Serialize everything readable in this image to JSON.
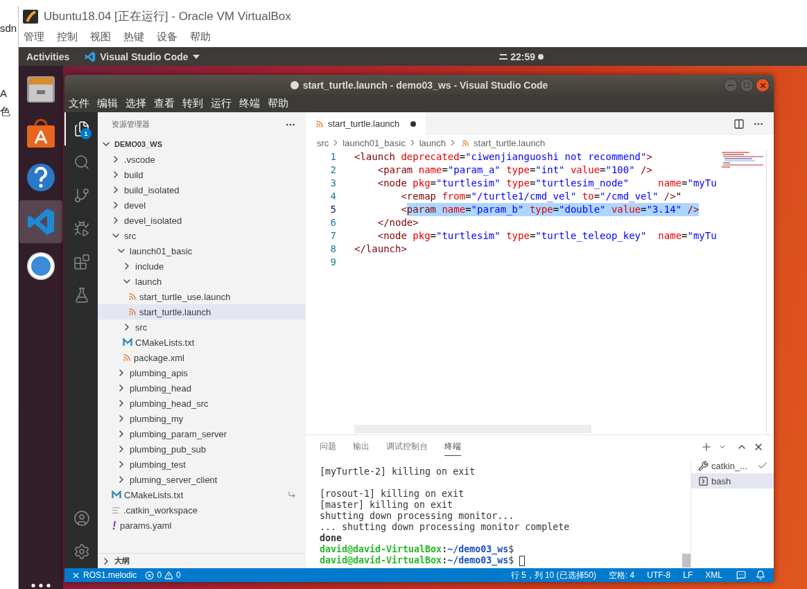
{
  "host_edge": [
    "sdn",
    "A",
    "色"
  ],
  "virtualbox": {
    "title": "Ubuntu18.04 [正在运行] - Oracle VM VirtualBox",
    "menu": [
      "管理",
      "控制",
      "视图",
      "热键",
      "设备",
      "帮助"
    ]
  },
  "top_bar": {
    "activities": "Activities",
    "app": "Visual Studio Code",
    "clock": "22:59"
  },
  "dock": [
    {
      "kind": "files",
      "selected": false
    },
    {
      "kind": "software",
      "selected": false
    },
    {
      "kind": "help",
      "selected": false
    },
    {
      "kind": "vscode",
      "selected": true
    },
    {
      "kind": "chrome",
      "selected": false
    }
  ],
  "vscode": {
    "title": "start_turtle.launch - demo03_ws - Visual Studio Code",
    "dirty": true,
    "menu": [
      "文件",
      "编辑",
      "选择",
      "查看",
      "转到",
      "运行",
      "终端",
      "帮助"
    ],
    "activity": [
      {
        "kind": "explorer",
        "selected": true,
        "badge": "1"
      },
      {
        "kind": "search",
        "selected": false
      },
      {
        "kind": "source-control",
        "selected": false
      },
      {
        "kind": "run",
        "selected": false
      },
      {
        "kind": "extensions",
        "selected": false
      },
      {
        "kind": "testing",
        "selected": false
      }
    ],
    "activity_bottom": [
      {
        "kind": "account"
      },
      {
        "kind": "settings"
      }
    ],
    "sidebar": {
      "title": "资源管理器",
      "root": {
        "name": "DEMO03_WS",
        "expanded": true
      },
      "tree": [
        {
          "name": ".vscode",
          "kind": "folder",
          "expanded": false,
          "selected": false
        },
        {
          "name": "build",
          "kind": "folder",
          "expanded": false,
          "selected": false
        },
        {
          "name": "build_isolated",
          "kind": "folder",
          "expanded": false,
          "selected": false
        },
        {
          "name": "devel",
          "kind": "folder",
          "expanded": false,
          "selected": false
        },
        {
          "name": "devel_isolated",
          "kind": "folder",
          "expanded": false,
          "selected": false
        },
        {
          "name": "src",
          "kind": "folder",
          "expanded": true,
          "selected": false,
          "children": [
            {
              "name": "launch01_basic",
              "kind": "folder",
              "expanded": true,
              "selected": false,
              "children": [
                {
                  "name": "include",
                  "kind": "folder",
                  "expanded": false,
                  "selected": false
                },
                {
                  "name": "launch",
                  "kind": "folder",
                  "expanded": true,
                  "selected": false,
                  "children": [
                    {
                      "name": "start_turtle_use.launch",
                      "kind": "xml",
                      "selected": false
                    },
                    {
                      "name": "start_turtle.launch",
                      "kind": "xml",
                      "selected": true
                    }
                  ]
                },
                {
                  "name": "src",
                  "kind": "folder",
                  "expanded": false,
                  "selected": false
                },
                {
                  "name": "CMakeLists.txt",
                  "kind": "cmake",
                  "selected": false
                },
                {
                  "name": "package.xml",
                  "kind": "xml",
                  "selected": false
                }
              ]
            },
            {
              "name": "plumbing_apis",
              "kind": "folder",
              "expanded": false,
              "selected": false
            },
            {
              "name": "plumbing_head",
              "kind": "folder",
              "expanded": false,
              "selected": false
            },
            {
              "name": "plumbing_head_src",
              "kind": "folder",
              "expanded": false,
              "selected": false
            },
            {
              "name": "plumbing_my",
              "kind": "folder",
              "expanded": false,
              "selected": false
            },
            {
              "name": "plumbing_param_server",
              "kind": "folder",
              "expanded": false,
              "selected": false
            },
            {
              "name": "plumbing_pub_sub",
              "kind": "folder",
              "expanded": false,
              "selected": false
            },
            {
              "name": "plumbing_test",
              "kind": "folder",
              "expanded": false,
              "selected": false
            },
            {
              "name": "pluming_server_client",
              "kind": "folder",
              "expanded": false,
              "selected": false
            }
          ]
        },
        {
          "name": "CMakeLists.txt",
          "kind": "cmake",
          "selected": false,
          "linked": true
        },
        {
          "name": ".catkin_workspace",
          "kind": "plain",
          "selected": false
        },
        {
          "name": "params.yaml",
          "kind": "yaml",
          "selected": false
        }
      ],
      "outline": {
        "label": "大纲",
        "expanded": false
      }
    },
    "editor": {
      "tabs": [
        {
          "label": "start_turtle.launch",
          "selected": true,
          "dirty": true
        }
      ],
      "breadcrumbs": [
        "src",
        "launch01_basic",
        "launch",
        "start_turtle.launch"
      ],
      "lines": [
        {
          "number": "1",
          "current": false,
          "tokens": [
            {
              "kind": "tag",
              "text": "<launch"
            },
            {
              "kind": "attr",
              "text": " deprecated"
            },
            {
              "kind": "plain",
              "text": "="
            },
            {
              "kind": "str",
              "text": "\"ciwenjianguoshi not recommend\""
            },
            {
              "kind": "tag",
              "text": ">"
            }
          ]
        },
        {
          "number": "2",
          "current": false,
          "tokens": [
            {
              "kind": "tag",
              "text": "    <param"
            },
            {
              "kind": "attr",
              "text": " name"
            },
            {
              "kind": "plain",
              "text": "="
            },
            {
              "kind": "str",
              "text": "\"param_a\""
            },
            {
              "kind": "attr",
              "text": " type"
            },
            {
              "kind": "plain",
              "text": "="
            },
            {
              "kind": "str",
              "text": "\"int\""
            },
            {
              "kind": "attr",
              "text": " value"
            },
            {
              "kind": "plain",
              "text": "="
            },
            {
              "kind": "str",
              "text": "\"100\""
            },
            {
              "kind": "tag",
              "text": " />"
            }
          ]
        },
        {
          "number": "3",
          "current": false,
          "tokens": [
            {
              "kind": "tag",
              "text": "    <node"
            },
            {
              "kind": "attr",
              "text": " pkg"
            },
            {
              "kind": "plain",
              "text": "="
            },
            {
              "kind": "str",
              "text": "\"turtlesim\""
            },
            {
              "kind": "attr",
              "text": " type"
            },
            {
              "kind": "plain",
              "text": "="
            },
            {
              "kind": "str",
              "text": "\"turtlesim_node\""
            },
            {
              "kind": "attr",
              "text": "     name"
            },
            {
              "kind": "plain",
              "text": "="
            },
            {
              "kind": "str",
              "text": "\"myTu"
            }
          ]
        },
        {
          "number": "4",
          "current": false,
          "tokens": [
            {
              "kind": "tag",
              "text": "        <remap"
            },
            {
              "kind": "attr",
              "text": " from"
            },
            {
              "kind": "plain",
              "text": "="
            },
            {
              "kind": "str",
              "text": "\"/turtle1/cmd_vel\""
            },
            {
              "kind": "attr",
              "text": " to"
            },
            {
              "kind": "plain",
              "text": "="
            },
            {
              "kind": "str",
              "text": "\"/cmd_vel\""
            },
            {
              "kind": "tag",
              "text": " />"
            },
            {
              "kind": "plain",
              "text": "\""
            }
          ]
        },
        {
          "number": "5",
          "current": true,
          "tokens": [
            {
              "kind": "tag",
              "text": "        <"
            }
          ],
          "selected_tokens": [
            {
              "kind": "tag",
              "text": "param"
            },
            {
              "kind": "attr",
              "text": " name"
            },
            {
              "kind": "plain",
              "text": "="
            },
            {
              "kind": "str",
              "text": "\"param_b\""
            },
            {
              "kind": "attr",
              "text": " type"
            },
            {
              "kind": "plain",
              "text": "="
            },
            {
              "kind": "str",
              "text": "\"double\""
            },
            {
              "kind": "attr",
              "text": " value"
            },
            {
              "kind": "plain",
              "text": "="
            },
            {
              "kind": "str",
              "text": "\"3.14\""
            },
            {
              "kind": "tag",
              "text": " />"
            }
          ]
        },
        {
          "number": "6",
          "current": false,
          "tokens": [
            {
              "kind": "tag",
              "text": "    </node>"
            }
          ]
        },
        {
          "number": "7",
          "current": false,
          "tokens": [
            {
              "kind": "tag",
              "text": "    <node"
            },
            {
              "kind": "attr",
              "text": " pkg"
            },
            {
              "kind": "plain",
              "text": "="
            },
            {
              "kind": "str",
              "text": "\"turtlesim\""
            },
            {
              "kind": "attr",
              "text": " type"
            },
            {
              "kind": "plain",
              "text": "="
            },
            {
              "kind": "str",
              "text": "\"turtle_teleop_key\""
            },
            {
              "kind": "attr",
              "text": "  name"
            },
            {
              "kind": "plain",
              "text": "="
            },
            {
              "kind": "str",
              "text": "\"myTu"
            }
          ]
        },
        {
          "number": "8",
          "current": false,
          "tokens": [
            {
              "kind": "tag",
              "text": "</launch>"
            }
          ]
        },
        {
          "number": "9",
          "current": false
        }
      ]
    },
    "panel": {
      "tabs": [
        {
          "label": "问题",
          "selected": false
        },
        {
          "label": "输出",
          "selected": false
        },
        {
          "label": "调试控制台",
          "selected": false
        },
        {
          "label": "终端",
          "selected": true
        }
      ],
      "terminal": [
        {
          "kind": "text",
          "text": "[myTurtle-2] killing on exit"
        },
        {
          "kind": "blank"
        },
        {
          "kind": "text",
          "text": "[rosout-1] killing on exit"
        },
        {
          "kind": "text",
          "text": "[master] killing on exit"
        },
        {
          "kind": "text",
          "text": "shutting down processing monitor..."
        },
        {
          "kind": "text",
          "text": "... shutting down processing monitor complete"
        },
        {
          "kind": "bold",
          "text": "done"
        },
        {
          "kind": "prompt",
          "user": "david@david-VirtualBox",
          "separator": ":",
          "path": "~/demo03_ws",
          "symbol": "$",
          "cursor": false
        },
        {
          "kind": "prompt",
          "user": "david@david-VirtualBox",
          "separator": ":",
          "path": "~/demo03_ws",
          "symbol": "$",
          "cursor": true
        }
      ],
      "sessions": [
        {
          "kind": "task",
          "label": "catkin_...",
          "done": true,
          "selected": false
        },
        {
          "kind": "shell",
          "label": "bash",
          "selected": true
        }
      ]
    },
    "status_bar": {
      "remote": "ROS1.melodic",
      "errors": "0",
      "warnings": "0",
      "items": [
        "行 5，列 10 (已选择50)",
        "空格: 4",
        "UTF-8",
        "LF",
        "XML"
      ]
    }
  }
}
